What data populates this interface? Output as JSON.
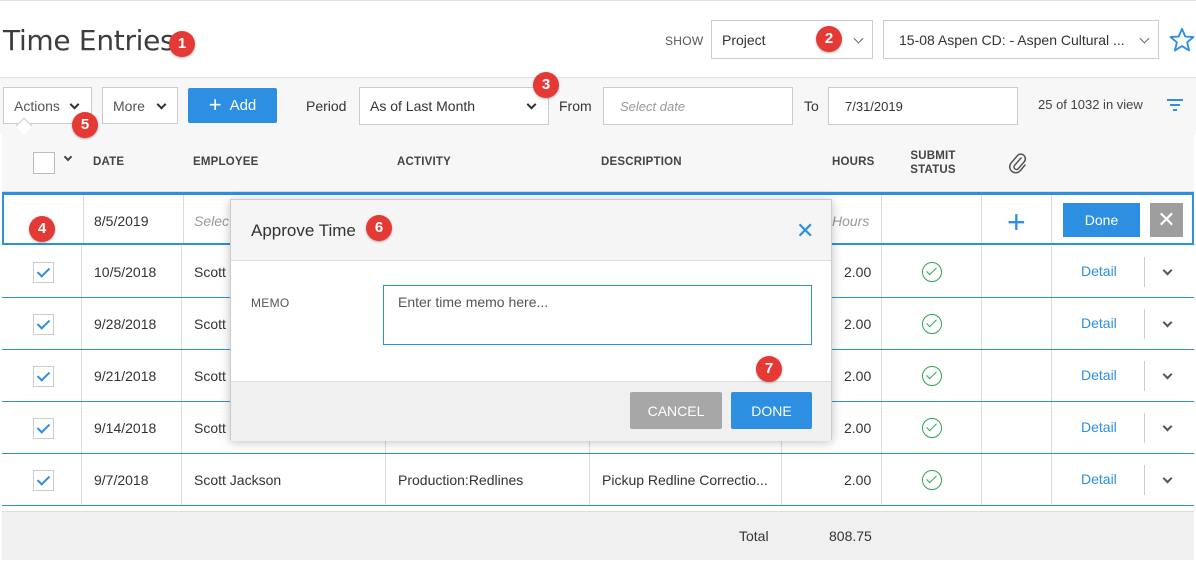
{
  "page": {
    "title": "Time Entries"
  },
  "show": {
    "label": "SHOW",
    "type_value": "Project",
    "project_value": "15-08 Aspen CD: - Aspen Cultural ..."
  },
  "toolbar": {
    "actions_label": "Actions",
    "more_label": "More",
    "add_label": "Add",
    "period_label": "Period",
    "period_value": "As of Last Month",
    "from_label": "From",
    "from_placeholder": "Select date",
    "to_label": "To",
    "to_value": "7/31/2019",
    "in_view": "25 of 1032 in view"
  },
  "table": {
    "headers": {
      "date": "DATE",
      "employee": "EMPLOYEE",
      "activity": "ACTIVITY",
      "description": "DESCRIPTION",
      "hours": "HOURS",
      "submit_status": "SUBMIT STATUS"
    },
    "edit_row": {
      "date": "8/5/2019",
      "employee_placeholder": "Selec",
      "hours_placeholder": "Hours",
      "done_label": "Done"
    },
    "rows": [
      {
        "date": "10/5/2018",
        "employee": "Scott",
        "activity": "",
        "description": "",
        "hours": "2.00",
        "detail": "Detail"
      },
      {
        "date": "9/28/2018",
        "employee": "Scott",
        "activity": "",
        "description": "",
        "hours": "2.00",
        "detail": "Detail"
      },
      {
        "date": "9/21/2018",
        "employee": "Scott",
        "activity": "",
        "description": "",
        "hours": "2.00",
        "detail": "Detail"
      },
      {
        "date": "9/14/2018",
        "employee": "Scott",
        "activity": "",
        "description": "",
        "hours": "2.00",
        "detail": "Detail"
      },
      {
        "date": "9/7/2018",
        "employee": "Scott Jackson",
        "activity": "Production:Redlines",
        "description": "Pickup Redline Correctio...",
        "hours": "2.00",
        "detail": "Detail"
      }
    ],
    "total_label": "Total",
    "total_value": "808.75"
  },
  "modal": {
    "title": "Approve Time",
    "memo_label": "MEMO",
    "memo_placeholder": "Enter time memo here...",
    "cancel_label": "CANCEL",
    "done_label": "DONE"
  },
  "badges": [
    "1",
    "2",
    "3",
    "4",
    "5",
    "6",
    "7"
  ],
  "colors": {
    "accent": "#2d8fe2",
    "badge": "#e53935",
    "status_ok": "#2ea44f"
  }
}
